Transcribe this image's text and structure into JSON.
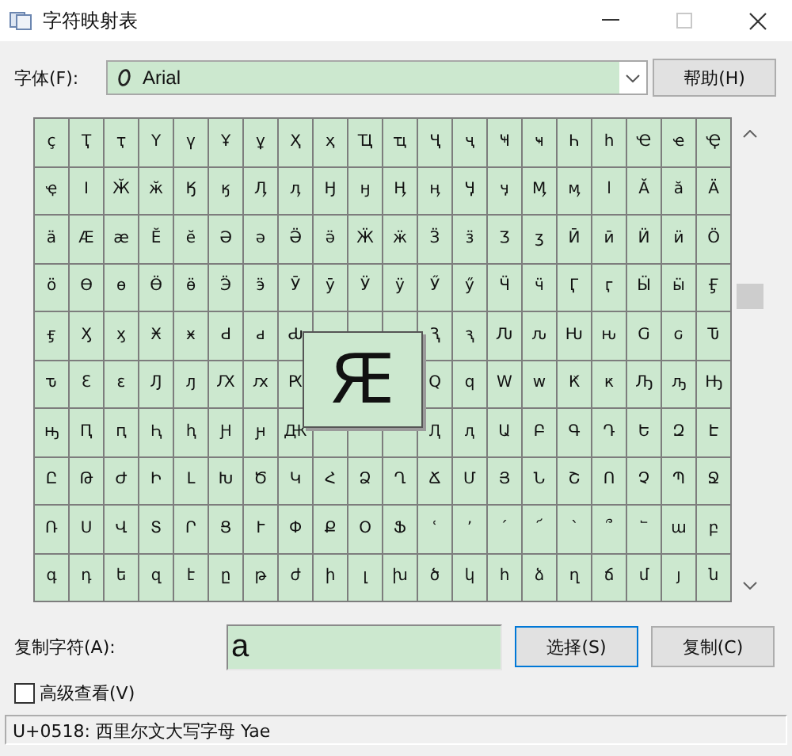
{
  "window": {
    "title": "字符映射表"
  },
  "font": {
    "label": "字体(F):",
    "value": "Arial"
  },
  "help_button": "帮助(H)",
  "grid": {
    "rows": [
      [
        "ҫ",
        "Ҭ",
        "ҭ",
        "Ү",
        "ү",
        "Ұ",
        "ұ",
        "Ҳ",
        "ҳ",
        "Ҵ",
        "ҵ",
        "Ҷ",
        "ҷ",
        "Ҹ",
        "ҹ",
        "Һ",
        "һ",
        "Ҽ",
        "ҽ",
        "Ҿ"
      ],
      [
        "ҿ",
        "Ӏ",
        "Ӂ",
        "ӂ",
        "Ӄ",
        "ӄ",
        "Ӆ",
        "ӆ",
        "Ӈ",
        "ӈ",
        "Ӊ",
        "ӊ",
        "Ӌ",
        "ӌ",
        "Ӎ",
        "ӎ",
        "ӏ",
        "Ӑ",
        "ӑ",
        "Ӓ"
      ],
      [
        "ӓ",
        "Ӕ",
        "ӕ",
        "Ӗ",
        "ӗ",
        "Ә",
        "ә",
        "Ӛ",
        "ӛ",
        "Ӝ",
        "ӝ",
        "Ӟ",
        "ӟ",
        "Ӡ",
        "ӡ",
        "Ӣ",
        "ӣ",
        "Ӥ",
        "ӥ",
        "Ӧ"
      ],
      [
        "ӧ",
        "Ө",
        "ө",
        "Ӫ",
        "ӫ",
        "Ӭ",
        "ӭ",
        "Ӯ",
        "ӯ",
        "Ӱ",
        "ӱ",
        "Ӳ",
        "ӳ",
        "Ӵ",
        "ӵ",
        "Ӷ",
        "ӷ",
        "Ӹ",
        "ӹ",
        "Ӻ"
      ],
      [
        "ӻ",
        "Ӽ",
        "ӽ",
        "Ӿ",
        "ӿ",
        "Ԁ",
        "ԁ",
        "Ԃ",
        null,
        null,
        null,
        "Ԇ",
        "ԇ",
        "Ԉ",
        "ԉ",
        "Ԋ",
        "ԋ",
        "Ԍ",
        "ԍ",
        "Ԏ"
      ],
      [
        "ԏ",
        "Ԑ",
        "ԑ",
        "Ԓ",
        "ԓ",
        "Ԕ",
        "ԕ",
        "Ԗ",
        null,
        null,
        null,
        "Ԛ",
        "ԛ",
        "Ԝ",
        "ԝ",
        "Ԟ",
        "ԟ",
        "Ԡ",
        "ԡ",
        "Ԣ"
      ],
      [
        "ԣ",
        "Ԥ",
        "ԥ",
        "Ԧ",
        "ԧ",
        "Ԩ",
        "ԩ",
        "Ԫ",
        null,
        null,
        null,
        "Ԯ",
        "ԯ",
        "Ա",
        "Բ",
        "Գ",
        "Դ",
        "Ե",
        "Զ",
        "Է"
      ],
      [
        "Ը",
        "Թ",
        "Ժ",
        "Ի",
        "Լ",
        "Խ",
        "Ծ",
        "Կ",
        "Հ",
        "Ձ",
        "Ղ",
        "Ճ",
        "Մ",
        "Յ",
        "Ն",
        "Շ",
        "Ո",
        "Չ",
        "Պ",
        "Ջ"
      ],
      [
        "Ռ",
        "Ս",
        "Վ",
        "Տ",
        "Ր",
        "Ց",
        "Ւ",
        "Փ",
        "Ք",
        "Օ",
        "Ֆ",
        "ՙ",
        "՚",
        "՛",
        "՜",
        "՝",
        "՞",
        "՟",
        "ա",
        "բ"
      ],
      [
        "գ",
        "դ",
        "ե",
        "զ",
        "է",
        "ը",
        "թ",
        "ժ",
        "ի",
        "լ",
        "խ",
        "ծ",
        "կ",
        "հ",
        "ձ",
        "ղ",
        "ճ",
        "մ",
        "յ",
        "ն"
      ]
    ]
  },
  "magnified": {
    "char": "Ԙ"
  },
  "copy": {
    "label": "复制字符(A):",
    "value": "a"
  },
  "buttons": [
    {
      "label": "选择(S)",
      "focused": true
    },
    {
      "label": "复制(C)",
      "focused": false
    }
  ],
  "advanced_view": {
    "label": "高级查看(V)",
    "checked": false
  },
  "status_bar": "U+0518: 西里尔文大写字母 Yae"
}
